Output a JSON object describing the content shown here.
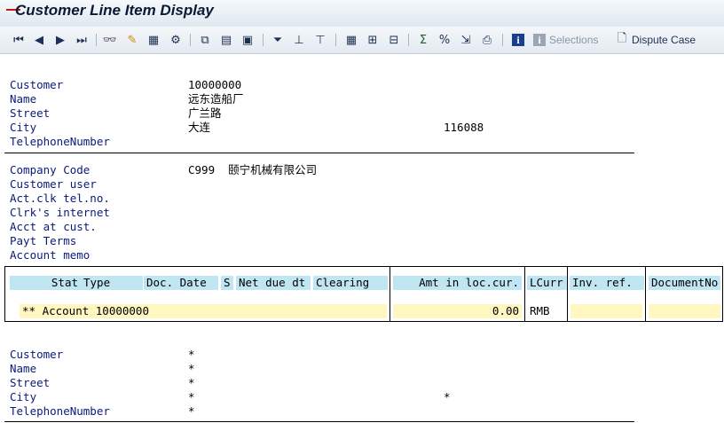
{
  "title": "Customer Line Item Display",
  "toolbar": {
    "icons": [
      "first-page",
      "previous-page",
      "next-page",
      "last-page",
      "glasses",
      "pencil",
      "select-layout",
      "choose",
      "copy",
      "save-layout",
      "local-file",
      "filter",
      "total",
      "subtotal",
      "grid-layout",
      "columns",
      "layout",
      "sum",
      "balance",
      "export",
      "print-preview",
      "info",
      "info-disabled"
    ],
    "selections_label": "Selections",
    "dispute_case_label": "Dispute Case"
  },
  "customer_header": {
    "customer_label": "Customer",
    "customer_value": "10000000",
    "name_label": "Name",
    "name_value": "远东造船厂",
    "street_label": "Street",
    "street_value": "广兰路",
    "city_label": "City",
    "city_value": "大连",
    "postal_code": "116088",
    "telephone_label": "TelephoneNumber"
  },
  "company_block": {
    "company_code_label": "Company Code",
    "company_code_value": "C999  颐宁机械有限公司",
    "customer_user_label": "Customer user",
    "clerk_tel_label": "Act.clk tel.no.",
    "clerk_internet_label": "Clrk's internet",
    "acct_at_cust_label": "Acct at cust.",
    "payt_terms_label": "Payt Terms",
    "account_memo_label": "Account memo"
  },
  "grid": {
    "columns": [
      "Stat",
      "Type",
      "Doc. Date",
      "S",
      "Net due dt",
      "Clearing",
      "Amt in loc.cur.",
      "LCurr",
      "Inv. ref.",
      "DocumentNo"
    ],
    "row": {
      "account": "** Account 10000000",
      "amount": "0.00",
      "currency": "RMB"
    }
  },
  "footer_block": {
    "customer_label": "Customer",
    "customer_value": "*",
    "name_label": "Name",
    "name_value": "*",
    "street_label": "Street",
    "street_value": "*",
    "city_label": "City",
    "city_value": "*",
    "city_value2": "*",
    "telephone_label": "TelephoneNumber",
    "telephone_value": "*"
  }
}
